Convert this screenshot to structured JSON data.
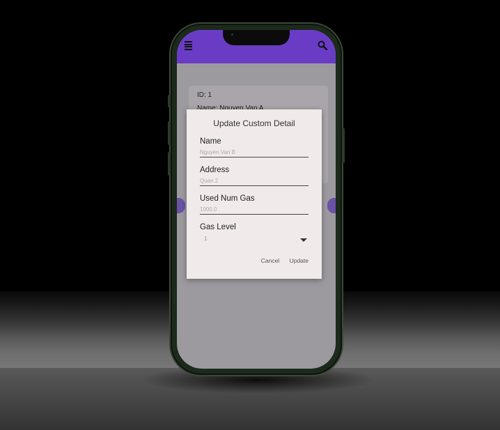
{
  "card": {
    "id_line": "ID: 1",
    "name_line": "Name: Nguyen Van A"
  },
  "dialog": {
    "title": "Update Custom Detail",
    "fields": {
      "name": {
        "label": "Name",
        "placeholder": "Nguyen Van B"
      },
      "address": {
        "label": "Address",
        "placeholder": "Quan 2"
      },
      "used_num_gas": {
        "label": "Used Num Gas",
        "placeholder": "1000.0"
      },
      "gas_level": {
        "label": "Gas Level",
        "selected": "1"
      }
    },
    "actions": {
      "cancel": "Cancel",
      "update": "Update"
    }
  },
  "colors": {
    "appbar": "#6a3cc6",
    "dialog_bg": "#f0ebea",
    "screen_dim": "#9d9a9f"
  },
  "icons": {
    "menu": "menu-icon",
    "search": "search-icon",
    "dropdown": "chevron-down-icon"
  }
}
